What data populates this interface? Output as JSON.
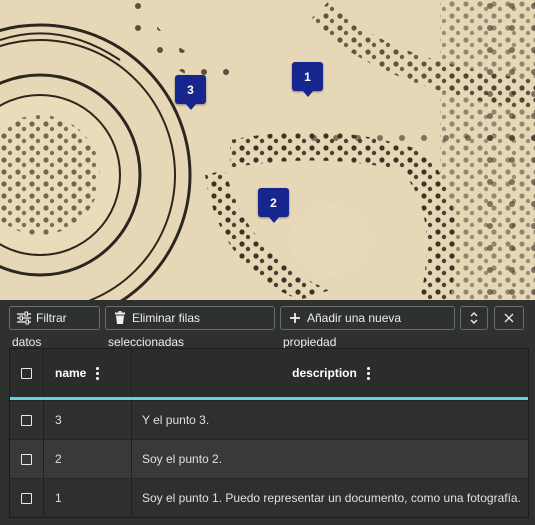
{
  "markers": [
    {
      "label": "1"
    },
    {
      "label": "2"
    },
    {
      "label": "3"
    }
  ],
  "toolbar": {
    "filter_label": "Filtrar",
    "filter_wrap": "datos",
    "delete_label": "Eliminar filas",
    "delete_wrap": "seleccionadas",
    "add_label": "Añadir una nueva",
    "add_wrap": "propiedad"
  },
  "table": {
    "columns": [
      "name",
      "description"
    ],
    "rows": [
      {
        "name": "3",
        "description": "Y el punto 3."
      },
      {
        "name": "2",
        "description": "Soy el punto 2."
      },
      {
        "name": "1",
        "description": "Soy el punto 1. Puedo representar un documento, como una fotografía."
      }
    ]
  },
  "colors": {
    "marker": "#17268f",
    "accent": "#5fd6dc",
    "panel": "#2f3131"
  },
  "icons": [
    "filter-icon",
    "trash-icon",
    "plus-icon",
    "expand-collapse-icon",
    "close-icon",
    "kebab-menu-icon"
  ]
}
